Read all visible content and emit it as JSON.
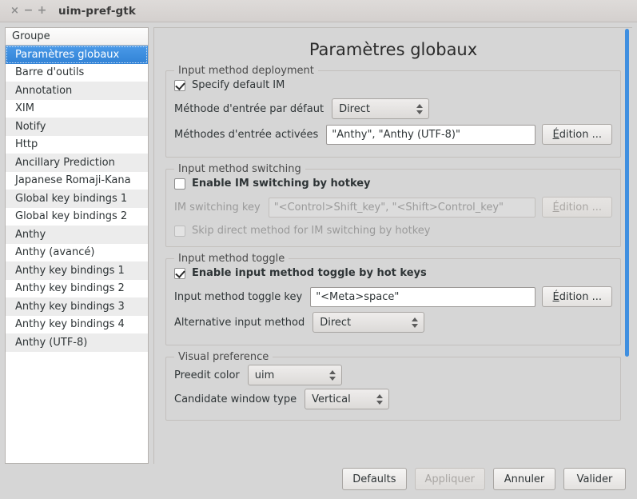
{
  "window": {
    "title": "uim-pref-gtk",
    "controls": {
      "close": "×",
      "minimize": "−",
      "maximize": "+"
    }
  },
  "sidebar": {
    "header": "Groupe",
    "items": [
      {
        "label": "Paramètres globaux",
        "selected": true
      },
      {
        "label": "Barre d'outils",
        "selected": false
      },
      {
        "label": "Annotation",
        "selected": false
      },
      {
        "label": "XIM",
        "selected": false
      },
      {
        "label": "Notify",
        "selected": false
      },
      {
        "label": "Http",
        "selected": false
      },
      {
        "label": "Ancillary Prediction",
        "selected": false
      },
      {
        "label": "Japanese Romaji-Kana",
        "selected": false
      },
      {
        "label": "Global key bindings 1",
        "selected": false
      },
      {
        "label": "Global key bindings 2",
        "selected": false
      },
      {
        "label": "Anthy",
        "selected": false
      },
      {
        "label": "Anthy (avancé)",
        "selected": false
      },
      {
        "label": "Anthy key bindings 1",
        "selected": false
      },
      {
        "label": "Anthy key bindings 2",
        "selected": false
      },
      {
        "label": "Anthy key bindings 3",
        "selected": false
      },
      {
        "label": "Anthy key bindings 4",
        "selected": false
      },
      {
        "label": "Anthy (UTF-8)",
        "selected": false
      }
    ]
  },
  "main": {
    "title": "Paramètres globaux",
    "deployment": {
      "legend": "Input method deployment",
      "specify_default_im_label": "Specify default IM",
      "default_method_label": "Méthode d'entrée par défaut",
      "default_method_value": "Direct",
      "enabled_methods_label": "Méthodes d'entrée activées",
      "enabled_methods_value": "\"Anthy\", \"Anthy (UTF-8)\"",
      "edit_button": "dition ...",
      "edit_button_mnemonic": "É"
    },
    "switching": {
      "legend": "Input method switching",
      "enable_label": "Enable IM switching by hotkey",
      "switch_key_label": "IM switching key",
      "switch_key_value": "\"<Control>Shift_key\", \"<Shift>Control_key\"",
      "edit_button": "dition ...",
      "edit_button_mnemonic": "É",
      "skip_direct_label": "Skip direct method for IM switching by hotkey"
    },
    "toggle": {
      "legend": "Input method toggle",
      "enable_label": "Enable input method toggle by hot keys",
      "toggle_key_label": "Input method toggle key",
      "toggle_key_value": "\"<Meta>space\"",
      "edit_button": "dition ...",
      "edit_button_mnemonic": "É",
      "alt_method_label": "Alternative input method",
      "alt_method_value": "Direct"
    },
    "visual": {
      "legend": "Visual preference",
      "preedit_color_label": "Preedit color",
      "preedit_color_value": "uim",
      "candidate_window_label": "Candidate window type",
      "candidate_window_value": "Vertical"
    }
  },
  "actions": {
    "defaults": "Defaults",
    "apply": "Appliquer",
    "cancel": "Annuler",
    "ok": "Valider"
  },
  "colors": {
    "accent": "#3a8ee0",
    "window_bg": "#d6d6d6",
    "list_bg": "#ffffff",
    "list_alt": "#ececec"
  }
}
